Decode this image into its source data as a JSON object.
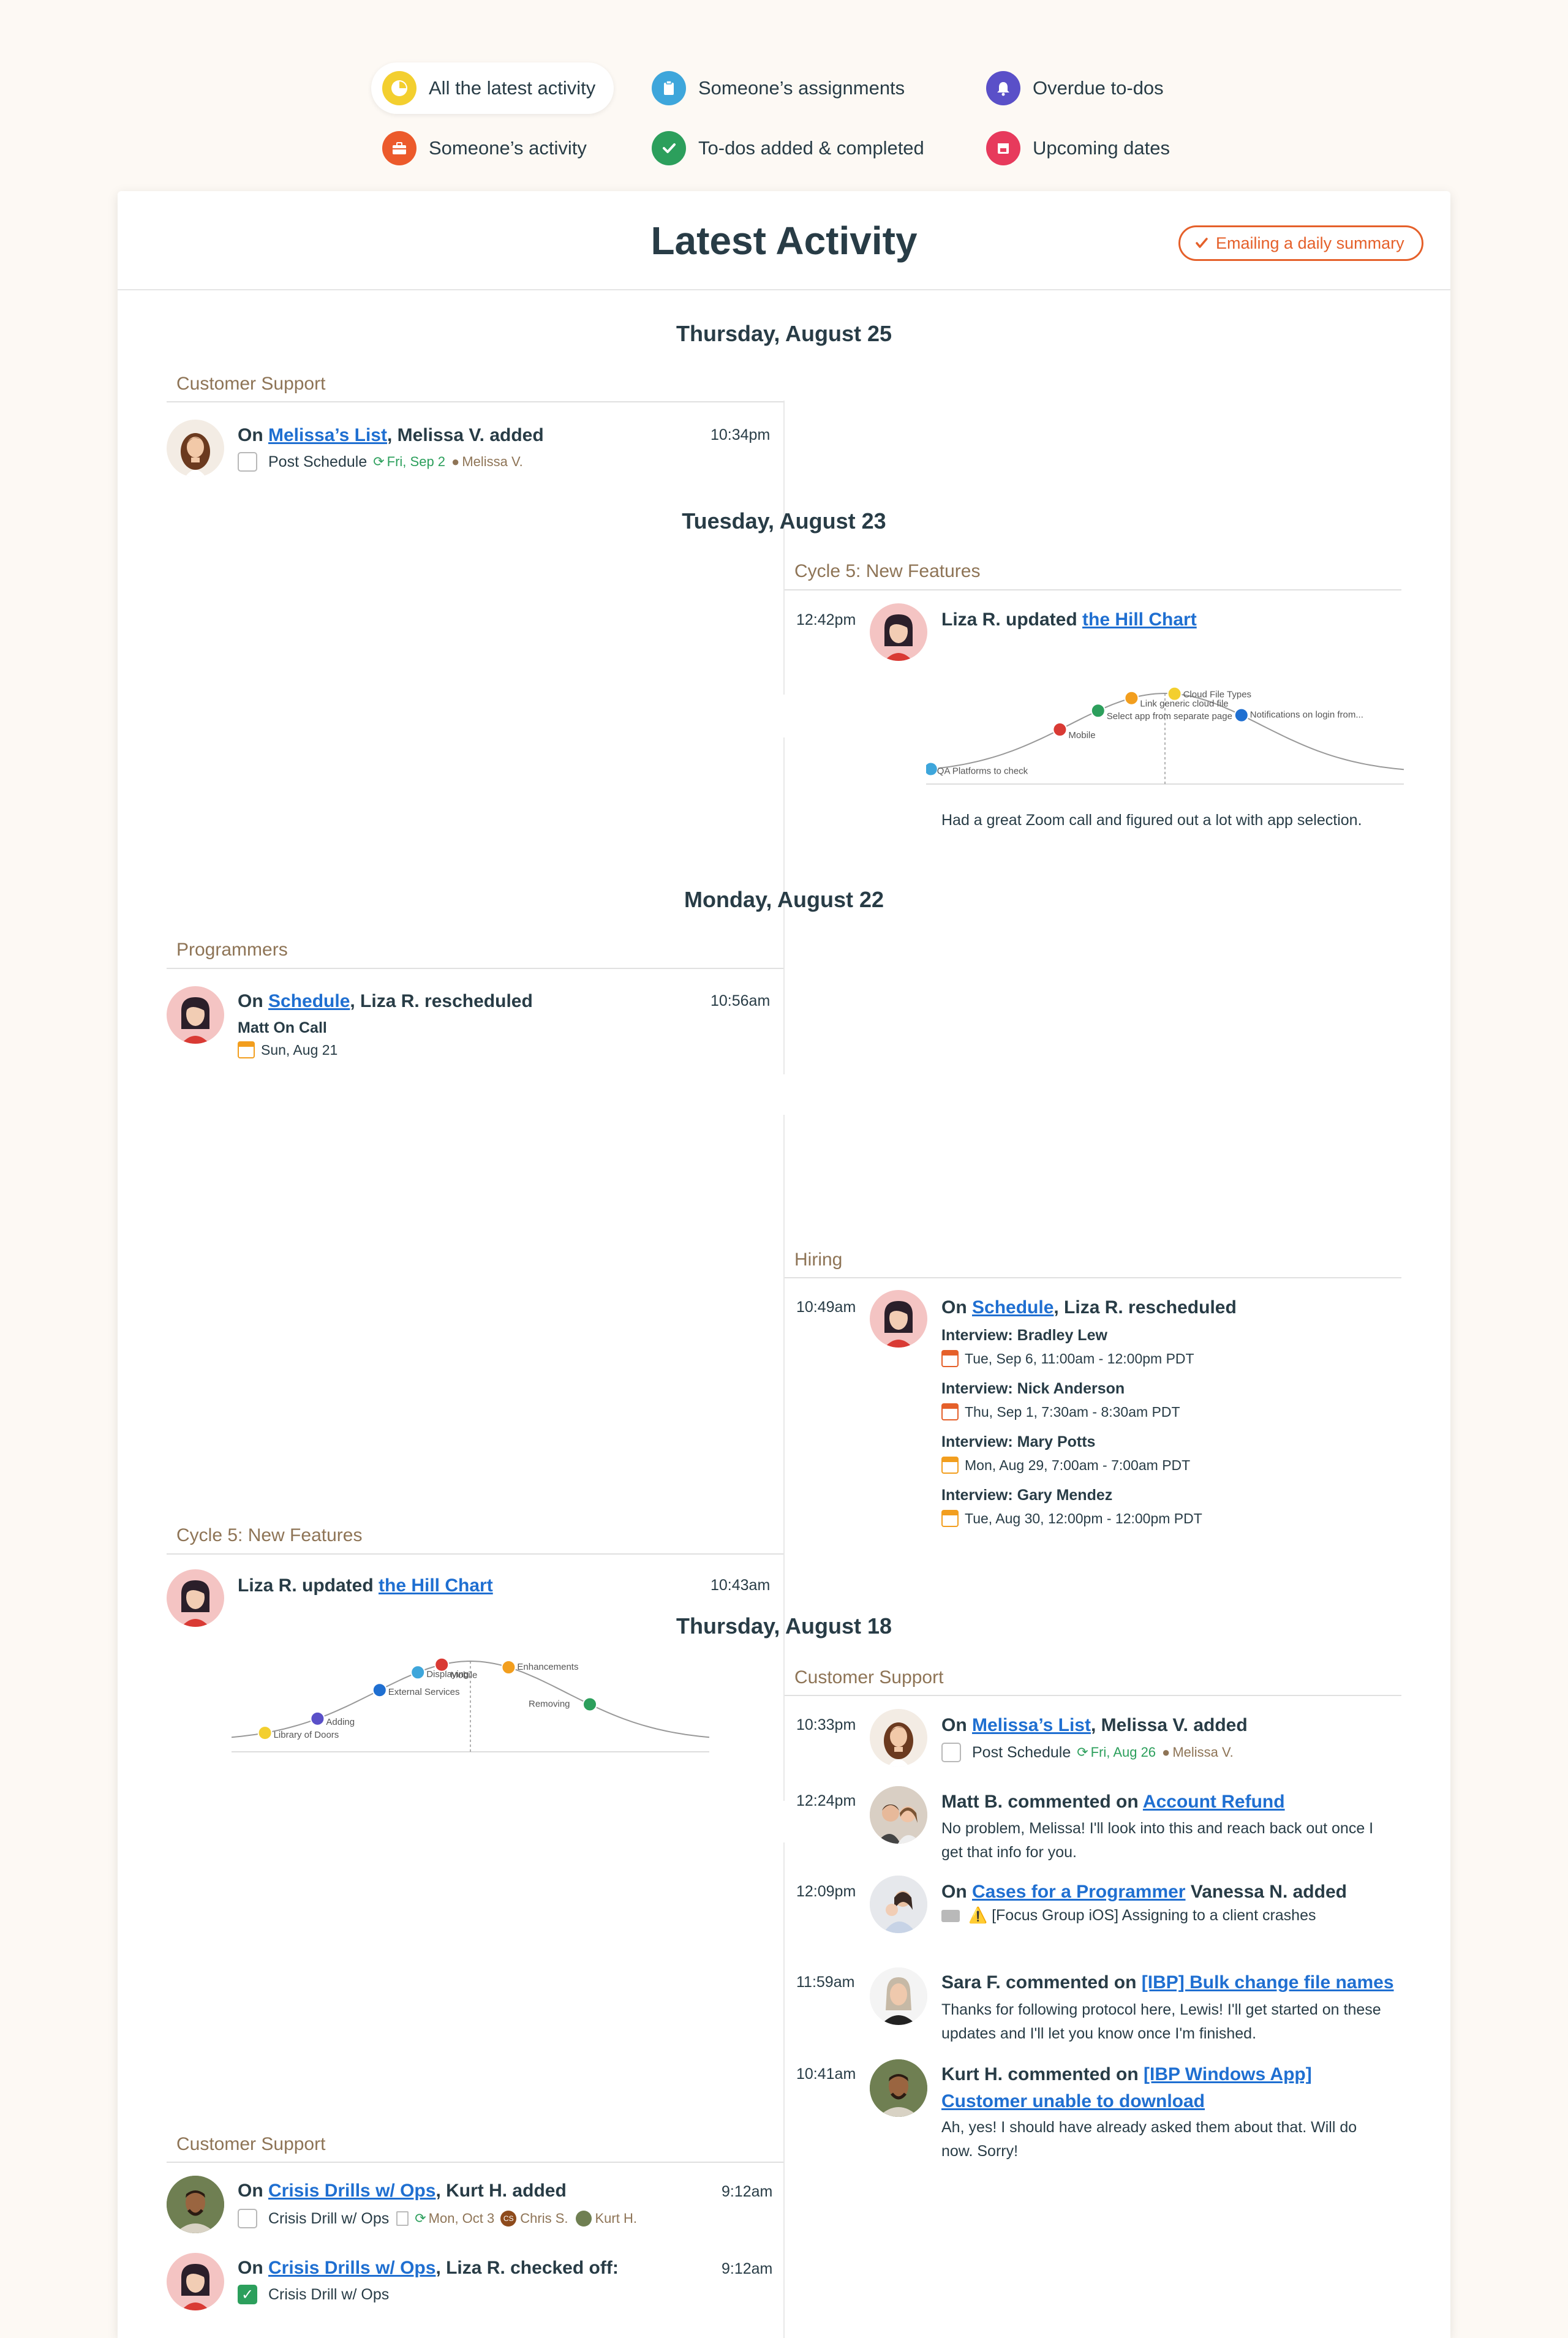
{
  "filters": [
    {
      "label": "All the latest activity",
      "icon": "pie-chart-icon",
      "color": "#f3cf2f",
      "active": true
    },
    {
      "label": "Someone’s assignments",
      "icon": "clipboard-icon",
      "color": "#3ea6db"
    },
    {
      "label": "Overdue to-dos",
      "icon": "bell-icon",
      "color": "#5a50c8"
    },
    {
      "label": "Someone’s activity",
      "icon": "briefcase-icon",
      "color": "#ec5a2b"
    },
    {
      "label": "To-dos added & completed",
      "icon": "checkmark-icon",
      "color": "#2c9f5c"
    },
    {
      "label": "Upcoming dates",
      "icon": "calendar-icon",
      "color": "#e73a5c"
    }
  ],
  "header": {
    "title": "Latest Activity",
    "email_label": "Emailing a daily summary",
    "accent": "#e5602a"
  },
  "days": {
    "d1": "Thursday, August 25",
    "d2": "Tuesday, August 23",
    "d3": "Monday, August 22",
    "d4": "Thursday, August 18"
  },
  "groups": {
    "customer_support": "Customer Support",
    "cycle5": "Cycle 5: New Features",
    "programmers": "Programmers",
    "hiring": "Hiring"
  },
  "events": {
    "e1": {
      "pre": "On ",
      "link": "Melissa’s List",
      "post": ", Melissa V. added",
      "time": "10:34pm",
      "todo": "Post Schedule",
      "date": "Fri, Sep 2",
      "person": "Melissa V."
    },
    "e2": {
      "pre": "Liza R. updated ",
      "link": "the Hill Chart",
      "time": "12:42pm",
      "note": "Had a great Zoom call and figured out a lot with app selection.",
      "hill": [
        {
          "label": "QA Platforms to check",
          "color": "#3ea6db"
        },
        {
          "label": "Mobile",
          "color": "#d93a34"
        },
        {
          "label": "Select app from separate page",
          "color": "#2c9f5c"
        },
        {
          "label": "Link generic cloud file",
          "color": "#f29e1e"
        },
        {
          "label": "Cloud File Types",
          "color": "#f3cf2f"
        },
        {
          "label": "Notifications on login from...",
          "color": "#1f6fd1"
        }
      ]
    },
    "e3": {
      "pre": "On ",
      "link": "Schedule",
      "post": ", Liza R. rescheduled",
      "time": "10:56am",
      "item": "Matt On Call",
      "date": "Sun, Aug 21"
    },
    "e4": {
      "pre": "On ",
      "link": "Schedule",
      "post": ", Liza R. rescheduled",
      "time": "10:49am",
      "items": [
        {
          "title": "Interview: Bradley Lew",
          "date": "Tue, Sep 6, 11:00am - 12:00pm PDT"
        },
        {
          "title": "Interview: Nick Anderson",
          "date": "Thu, Sep 1, 7:30am - 8:30am PDT"
        },
        {
          "title": "Interview: Mary Potts",
          "date": "Mon, Aug 29, 7:00am - 7:00am PDT"
        },
        {
          "title": "Interview: Gary Mendez",
          "date": "Tue, Aug 30, 12:00pm - 12:00pm PDT"
        }
      ]
    },
    "e5": {
      "pre": "Liza R. updated ",
      "link": "the Hill Chart",
      "time": "10:43am",
      "hill": [
        {
          "label": "Library of Doors",
          "color": "#f3cf2f"
        },
        {
          "label": "Adding",
          "color": "#5a50c8"
        },
        {
          "label": "External Services",
          "color": "#1f6fd1"
        },
        {
          "label": "Displaying",
          "color": "#3ea6db"
        },
        {
          "label": "Mobile",
          "color": "#d93a34"
        },
        {
          "label": "Enhancements",
          "color": "#f29e1e"
        },
        {
          "label": "Removing",
          "color": "#2c9f5c"
        }
      ]
    },
    "e6": {
      "pre": "On ",
      "link": "Melissa’s List",
      "post": ", Melissa V. added",
      "time": "10:33pm",
      "todo": "Post Schedule",
      "date": "Fri, Aug 26",
      "person": "Melissa V."
    },
    "e7": {
      "pre": "Matt B. commented on ",
      "link": "Account Refund",
      "time": "12:24pm",
      "text": "No problem, Melissa! I'll look into this and reach back out once I get that info for you."
    },
    "e8": {
      "pre": "On ",
      "link": "Cases for a Programmer",
      "post": " Vanessa N. added",
      "time": "12:09pm",
      "text": "⚠️  [Focus Group iOS] Assigning to a client crashes"
    },
    "e9": {
      "pre": "Sara F. commented on ",
      "link": "[IBP] Bulk change file names",
      "time": "11:59am",
      "text": "Thanks for following protocol here, Lewis! I'll get started on these updates and I'll let you know once I'm finished."
    },
    "e10": {
      "pre": "Kurt H. commented on ",
      "link": "[IBP Windows App]",
      "link2": "Customer unable to download",
      "time": "10:41am",
      "text": "Ah, yes! I should have already asked them about that. Will do now. Sorry!"
    },
    "e11": {
      "pre": "On ",
      "link": "Crisis Drills w/ Ops",
      "post": ", Kurt H. added",
      "time": "9:12am",
      "todo": "Crisis Drill w/ Ops",
      "date": "Mon, Oct 3",
      "person1": "Chris S.",
      "person1_initials": "CS",
      "person2": "Kurt H."
    },
    "e12": {
      "pre": "On ",
      "link": "Crisis Drills w/ Ops",
      "post": ", Liza R. checked off:",
      "time": "9:12am",
      "todo": "Crisis Drill w/ Ops"
    }
  }
}
